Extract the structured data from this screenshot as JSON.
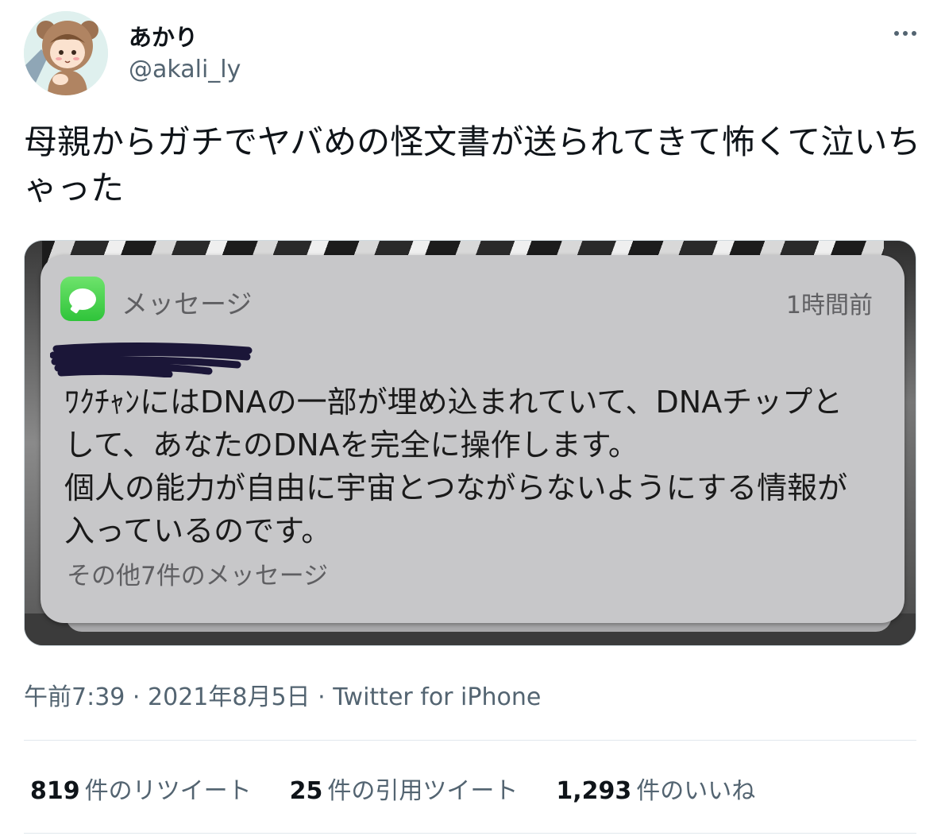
{
  "user": {
    "display_name": "あかり",
    "handle": "@akali_ly"
  },
  "tweet": {
    "text": "母親からガチでヤバめの怪文書が送られてきて怖くて泣いちゃった"
  },
  "notification": {
    "app_name": "メッセージ",
    "time": "1時間前",
    "body_lines": [
      "ﾜｸﾁｬﾝにはDNAの一部が埋め込まれていて、DNAチップと",
      "して、あなたのDNAを完全に操作します。",
      "個人の能力が自由に宇宙とつながらないようにする情報が",
      "入っているのです。"
    ],
    "more_messages": "その他7件のメッセージ"
  },
  "meta": {
    "time": "午前7:39",
    "separator": "·",
    "date": "2021年8月5日",
    "source": "Twitter for iPhone"
  },
  "stats": {
    "retweets_count": "819",
    "retweets_label": "件のリツイート",
    "quotes_count": "25",
    "quotes_label": "件の引用ツイート",
    "likes_count": "1,293",
    "likes_label": "件のいいね"
  },
  "colors": {
    "text_primary": "#0f1419",
    "text_secondary": "#536471",
    "messages_green": "#34c759",
    "notification_bg": "#c7c7c9"
  }
}
